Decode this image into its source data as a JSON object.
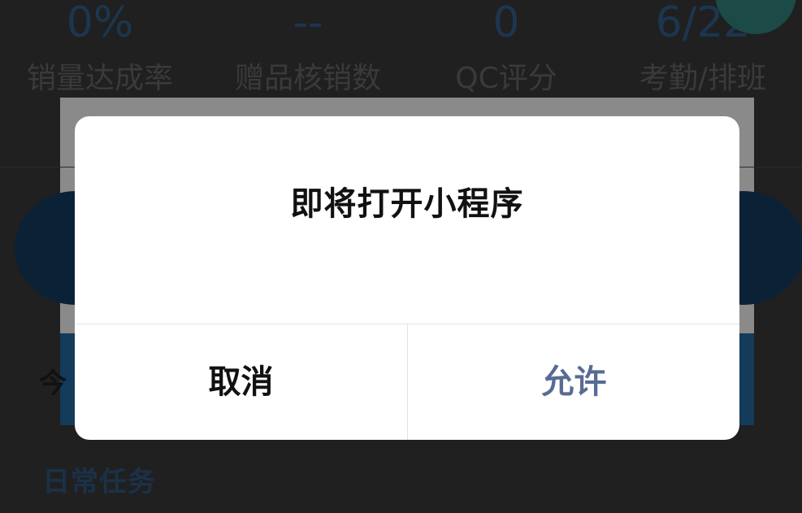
{
  "background": {
    "stats": [
      {
        "value": "0%",
        "label": "销量达成率"
      },
      {
        "value": "--",
        "label": "赠品核销数"
      },
      {
        "value": "0",
        "label": "QC评分"
      },
      {
        "value": "6/22",
        "label": "考勤/排班"
      }
    ],
    "tab_partial_text": "今",
    "section_title": "日常任务"
  },
  "dialog": {
    "title": "即将打开小程序",
    "cancel_label": "取消",
    "allow_label": "允许"
  },
  "colors": {
    "allow_text": "#576b95",
    "dialog_bg": "#ffffff",
    "overlay": "#202020"
  }
}
